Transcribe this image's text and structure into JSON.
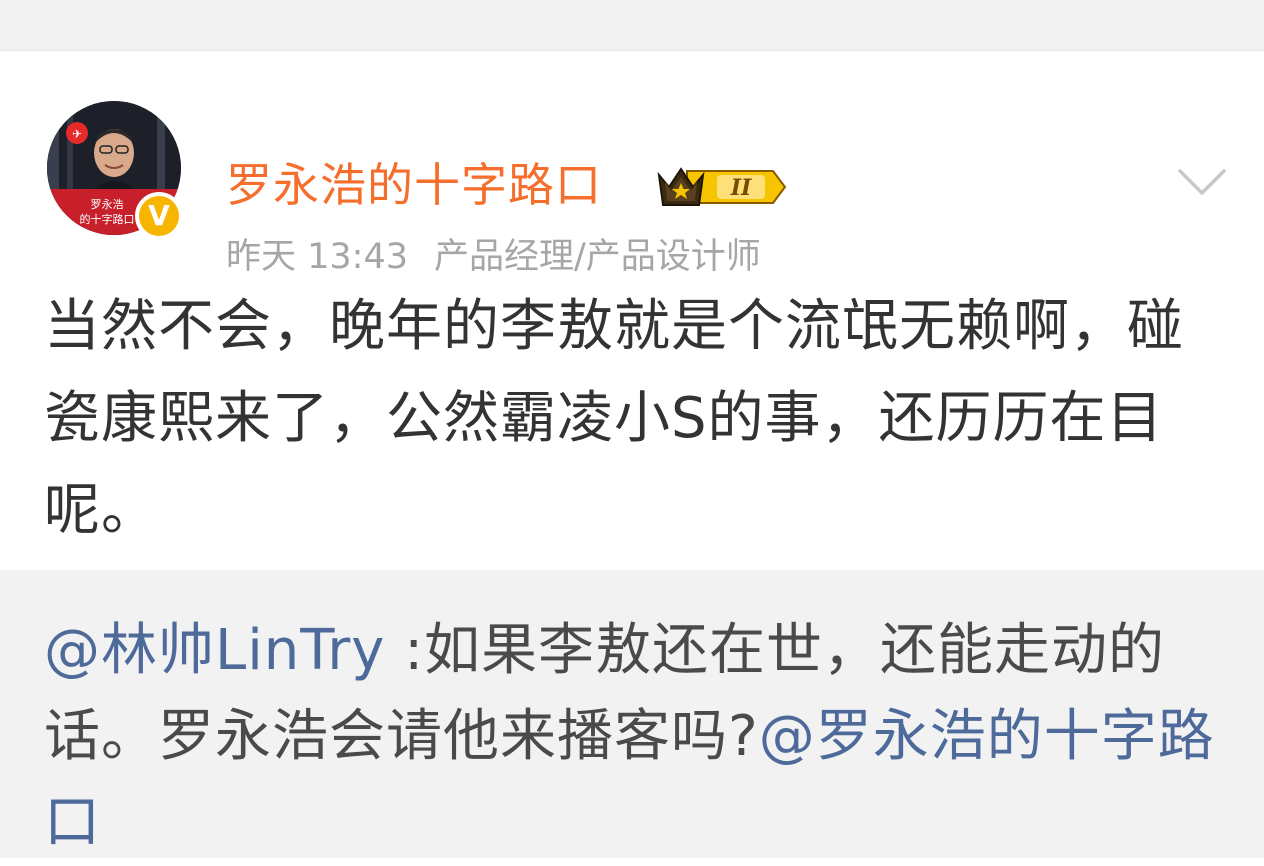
{
  "post": {
    "author_name": "罗永浩的十字路口",
    "vip_level": "II",
    "avatar_text": "罗永浩的十字路口",
    "verified_label": "V",
    "timestamp": "昨天 13:43",
    "source": "产品经理/产品设计师",
    "text": "当然不会，晚年的李敖就是个流氓无赖啊，碰瓷康熙来了，公然霸凌小S的事，还历历在目呢。"
  },
  "quoted": {
    "mention_user": "@林帅LinTry",
    "text_body": " :如果李敖还在世，还能走动的话。罗永浩会请他来播客吗?",
    "mention_target": "@罗永浩的十字路口"
  },
  "colors": {
    "author_name": "#f56e2c",
    "mention": "#4d6a9a",
    "meta_text": "#a6a6a6",
    "quoted_bg": "#f2f2f2",
    "verified_badge": "#f7b500"
  },
  "icons": {
    "vip": "crown-vip-badge-icon",
    "menu": "chevron-down-icon",
    "verified": "verified-v-icon"
  }
}
